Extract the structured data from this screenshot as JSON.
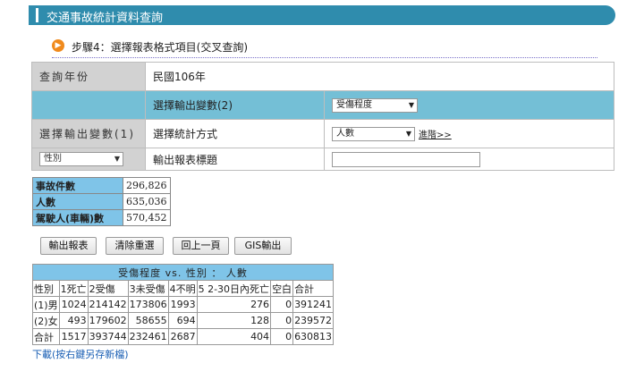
{
  "page_title": "交通事故統計資料查詢",
  "step": {
    "icon": "arrow-right-circle-icon",
    "text": "步驟4：選擇報表格式項目(交叉查詢)"
  },
  "form": {
    "year_label": "查詢年份",
    "year_value": "民國106年",
    "var2_label": "選擇輸出變數(2)",
    "var2_select": "受傷程度",
    "var1_label": "選擇輸出變數(1)",
    "stat_label": "選擇統計方式",
    "stat_select": "人數",
    "advanced_link": "進階>>",
    "var1_select": "性別",
    "report_title_label": "輸出報表標題",
    "report_title_value": ""
  },
  "summary": [
    {
      "label": "事故件數",
      "value": "296,826"
    },
    {
      "label": "人數",
      "value": "635,036"
    },
    {
      "label": "駕駛人(車輛)數",
      "value": "570,452"
    }
  ],
  "buttons": {
    "output": "輸出報表",
    "reset": "清除重選",
    "back": "回上一頁",
    "gis": "GIS輸出"
  },
  "result": {
    "title": "受傷程度      vs. 性別 ： 人數",
    "headers": [
      "性別",
      "1死亡",
      "2受傷",
      "3未受傷",
      "4不明",
      "5 2-30日內死亡",
      "空白",
      "合計"
    ],
    "rows": [
      [
        "(1)男",
        "1024",
        "214142",
        "173806",
        "1993",
        "276",
        "0",
        "391241"
      ],
      [
        "(2)女",
        "493",
        "179602",
        "58655",
        "694",
        "128",
        "0",
        "239572"
      ],
      [
        "合計",
        "1517",
        "393744",
        "232461",
        "2687",
        "404",
        "0",
        "630813"
      ]
    ]
  },
  "download_link": "下載(按右鍵另存新檔)"
}
